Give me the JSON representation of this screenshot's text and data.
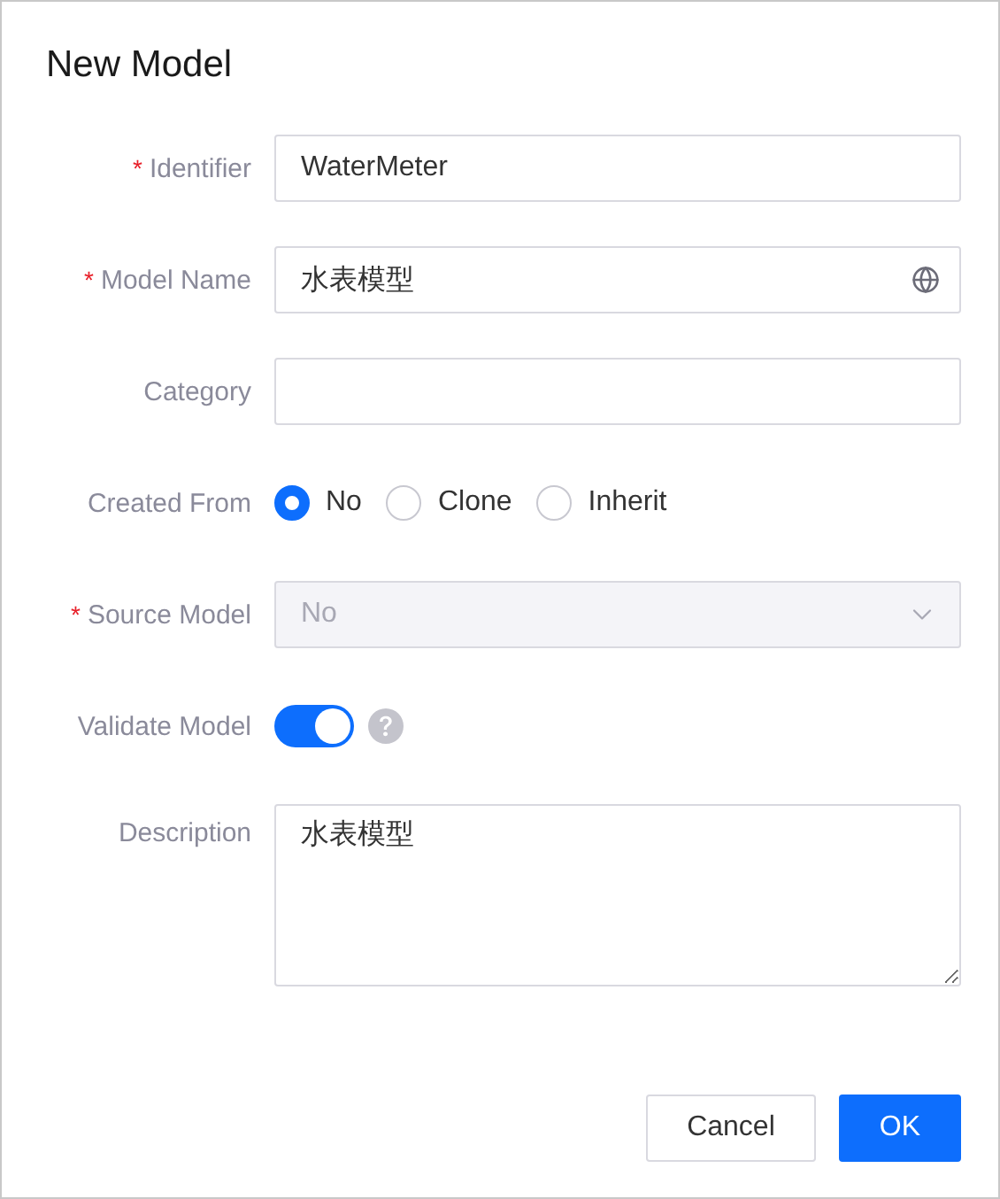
{
  "dialog": {
    "title": "New Model"
  },
  "required_mark": "*",
  "form": [
    {
      "kind": "text",
      "label": "Identifier",
      "required": true,
      "value": "WaterMeter"
    },
    {
      "kind": "text",
      "label": "Model Name",
      "required": true,
      "value": "水表模型",
      "has_language_icon": true
    },
    {
      "kind": "text",
      "label": "Category",
      "required": false
    },
    {
      "kind": "radio",
      "label": "Created From",
      "required": false,
      "options": [
        {
          "label": "No",
          "selected": true
        },
        {
          "label": "Clone",
          "selected": false
        },
        {
          "label": "Inherit",
          "selected": false
        }
      ]
    },
    {
      "kind": "select",
      "label": "Source Model",
      "required": true,
      "value": "No",
      "disabled": true
    },
    {
      "kind": "switch",
      "label": "Validate Model",
      "required": false,
      "on": true,
      "has_help_icon": true
    },
    {
      "kind": "textarea",
      "label": "Description",
      "required": false,
      "value": "水表模型"
    }
  ],
  "buttons": [
    {
      "label": "Cancel",
      "primary": false
    },
    {
      "label": "OK",
      "primary": true
    }
  ]
}
